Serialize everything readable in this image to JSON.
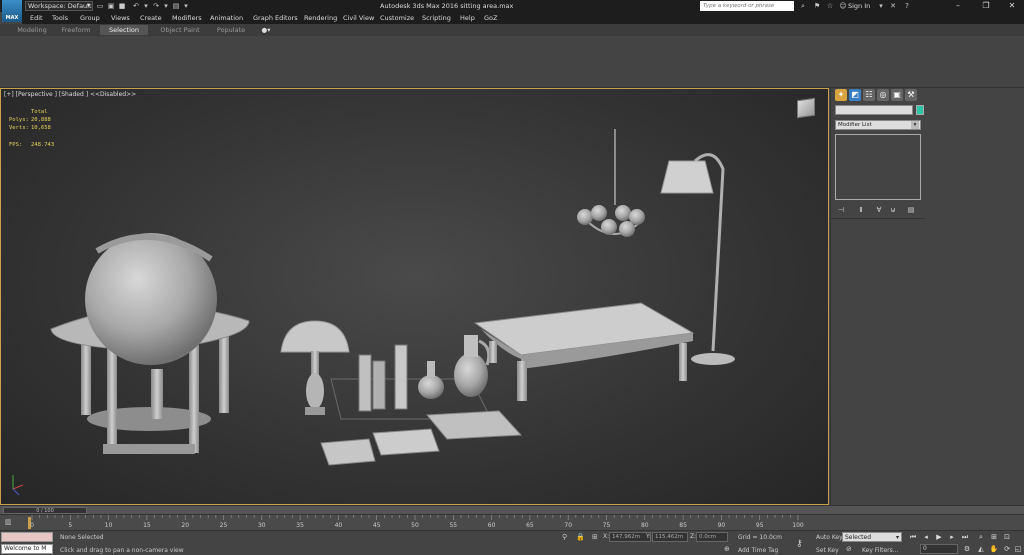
{
  "titlebar": {
    "logo": "MAX",
    "workspace": "Workspace: Default",
    "title": "Autodesk 3ds Max 2016    sitting area.max",
    "search_placeholder": "Type a keyword or phrase",
    "sign_in": "Sign In"
  },
  "menu": [
    "Edit",
    "Tools",
    "Group",
    "Views",
    "Create",
    "Modifiers",
    "Animation",
    "Graph Editors",
    "Rendering",
    "Civil View",
    "Customize",
    "Scripting",
    "Help",
    "GoZ"
  ],
  "ribbon_tabs": [
    "Modeling",
    "Freeform",
    "Selection",
    "Object Paint",
    "Populate"
  ],
  "viewport": {
    "label": "[+] [Perspective ] [Shaded ]  <<Disabled>>",
    "stats_total": "Total",
    "polys_label": "Polys:",
    "polys_value": "20,888",
    "verts_label": "Verts:",
    "verts_value": "10,658",
    "fps_label": "FPS:",
    "fps_value": "248.743"
  },
  "command_panel": {
    "modifier_list": "Modifier List",
    "accent": "#2fc4a6"
  },
  "timeline": {
    "slider": "0 / 100",
    "ticks": [
      "0",
      "5",
      "10",
      "15",
      "20",
      "25",
      "30",
      "35",
      "40",
      "45",
      "50",
      "55",
      "60",
      "65",
      "70",
      "75",
      "80",
      "85",
      "90",
      "95",
      "100"
    ]
  },
  "status": {
    "maxscript": "Welcome to M",
    "selection": "None Selected",
    "prompt": "Click and drag to pan a non-camera view",
    "x_label": "X:",
    "x_value": "147.962m",
    "y_label": "Y:",
    "y_value": "115.462m",
    "z_label": "Z:",
    "z_value": "0.0cm",
    "grid": "Grid = 10.0cm",
    "add_time_tag": "Add Time Tag",
    "auto_key": "Auto Key",
    "set_key": "Set Key",
    "selected": "Selected",
    "key_filters": "Key Filters...",
    "frame": "0"
  }
}
